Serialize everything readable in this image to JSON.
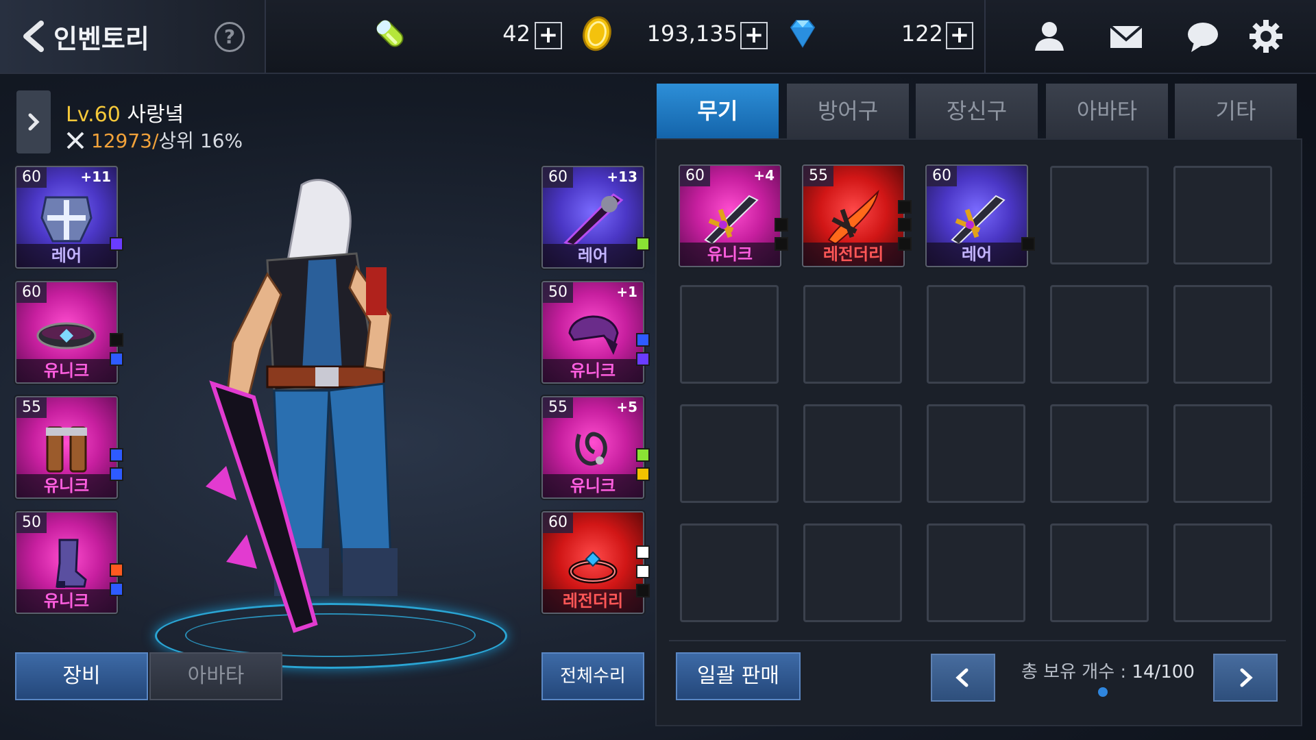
{
  "header": {
    "title": "인벤토리",
    "help": "?",
    "currencies": [
      {
        "icon": "energy-capsule-icon",
        "value": "42"
      },
      {
        "icon": "gold-coin-icon",
        "value": "193,135"
      },
      {
        "icon": "diamond-gem-icon",
        "value": "122"
      }
    ],
    "plus": "+",
    "icons": [
      "friend-icon",
      "mail-icon",
      "chat-icon",
      "settings-gear-icon"
    ]
  },
  "character": {
    "level_prefix": "Lv.60",
    "name": "사랑녘",
    "power": "12973/",
    "rank": "상위 16%"
  },
  "equipment_left": [
    {
      "level": "60",
      "plus": "+11",
      "grade": "레어",
      "rarity": "rare",
      "item": "chest-armor-icon",
      "gems": [
        "#6a3cff"
      ]
    },
    {
      "level": "60",
      "plus": "",
      "grade": "유니크",
      "rarity": "unique",
      "item": "belt-icon",
      "gems": [
        "#111111",
        "#2e5bff"
      ]
    },
    {
      "level": "55",
      "plus": "",
      "grade": "유니크",
      "rarity": "unique",
      "item": "leg-armor-icon",
      "gems": [
        "#2e5bff",
        "#2e5bff"
      ]
    },
    {
      "level": "50",
      "plus": "",
      "grade": "유니크",
      "rarity": "unique",
      "item": "boots-icon",
      "gems": [
        "#ff5a1f",
        "#2e5bff"
      ]
    }
  ],
  "equipment_right": [
    {
      "level": "60",
      "plus": "+13",
      "grade": "레어",
      "rarity": "rare",
      "item": "greatsword-icon",
      "gems": [
        "#8ae234"
      ]
    },
    {
      "level": "50",
      "plus": "+1",
      "grade": "유니크",
      "rarity": "unique",
      "item": "helmet-icon",
      "gems": [
        "#2e5bff",
        "#6a3cff"
      ]
    },
    {
      "level": "55",
      "plus": "+5",
      "grade": "유니크",
      "rarity": "unique",
      "item": "necklace-icon",
      "gems": [
        "#8ae234",
        "#f2c200"
      ]
    },
    {
      "level": "60",
      "plus": "",
      "grade": "레전더리",
      "rarity": "legend",
      "item": "ring-icon",
      "gems": [
        "#ffffff",
        "#ffffff",
        "#111111"
      ]
    }
  ],
  "bottom_left": {
    "equip_tab": "장비",
    "avatar_tab": "아바타",
    "repair_all": "전체수리"
  },
  "inventory": {
    "tabs": [
      "무기",
      "방어구",
      "장신구",
      "아바타",
      "기타"
    ],
    "active_tab": 0,
    "items": [
      {
        "level": "60",
        "plus": "+4",
        "grade": "유니크",
        "rarity": "unique",
        "item": "sword-icon",
        "gems": [
          "#111111",
          "#111111"
        ]
      },
      {
        "level": "55",
        "plus": "",
        "grade": "레전더리",
        "rarity": "legend",
        "item": "flame-sword-icon",
        "gems": [
          "#111111",
          "#111111",
          "#111111"
        ]
      },
      {
        "level": "60",
        "plus": "",
        "grade": "레어",
        "rarity": "rare",
        "item": "sword-icon",
        "gems": [
          "#111111"
        ]
      }
    ],
    "total_slots_visible": 20,
    "bulk_sell": "일괄 판매",
    "count_label": "총 보유 개수 : ",
    "count_value": "14/100",
    "prev": "‹",
    "next": "›"
  }
}
